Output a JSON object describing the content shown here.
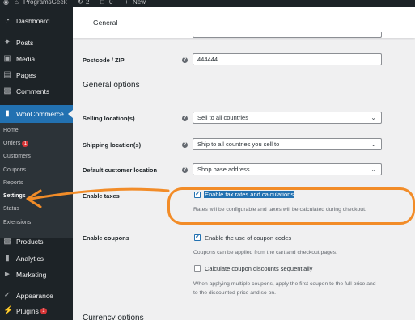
{
  "admin_bar": {
    "site_name": "ProgramsGeek",
    "updates_count": "2",
    "comments_count": "0",
    "new_label": "New"
  },
  "sidebar": {
    "dashboard": "Dashboard",
    "posts": "Posts",
    "media": "Media",
    "pages": "Pages",
    "comments": "Comments",
    "woocommerce": "WooCommerce",
    "submenu": {
      "home": "Home",
      "orders": "Orders",
      "orders_badge": "1",
      "customers": "Customers",
      "coupons": "Coupons",
      "reports": "Reports",
      "settings": "Settings",
      "status": "Status",
      "extensions": "Extensions"
    },
    "products": "Products",
    "analytics": "Analytics",
    "marketing": "Marketing",
    "appearance": "Appearance",
    "plugins": "Plugins",
    "plugins_badge": "1"
  },
  "tabs": {
    "general": "General"
  },
  "form": {
    "postcode_label": "Postcode / ZIP",
    "postcode_value": "444444",
    "general_options_title": "General options",
    "selling_label": "Selling location(s)",
    "selling_value": "Sell to all countries",
    "shipping_label": "Shipping location(s)",
    "shipping_value": "Ship to all countries you sell to",
    "default_customer_label": "Default customer location",
    "default_customer_value": "Shop base address",
    "enable_taxes_label": "Enable taxes",
    "enable_taxes_option": "Enable tax rates and calculations",
    "enable_taxes_checked": true,
    "enable_taxes_desc": "Rates will be configurable and taxes will be calculated during checkout.",
    "enable_coupons_label": "Enable coupons",
    "enable_coupons_option": "Enable the use of coupon codes",
    "enable_coupons_checked": true,
    "enable_coupons_desc": "Coupons can be applied from the cart and checkout pages.",
    "sequential_option": "Calculate coupon discounts sequentially",
    "sequential_checked": false,
    "sequential_desc_line1": "When applying multiple coupons, apply the first coupon to the full price and",
    "sequential_desc_line2": "to the discounted price and so on.",
    "currency_options_title": "Currency options"
  },
  "colors": {
    "accent": "#2271b1",
    "annotation": "#f28c28",
    "sidebar_bg": "#1d2327",
    "badge": "#d63638"
  }
}
